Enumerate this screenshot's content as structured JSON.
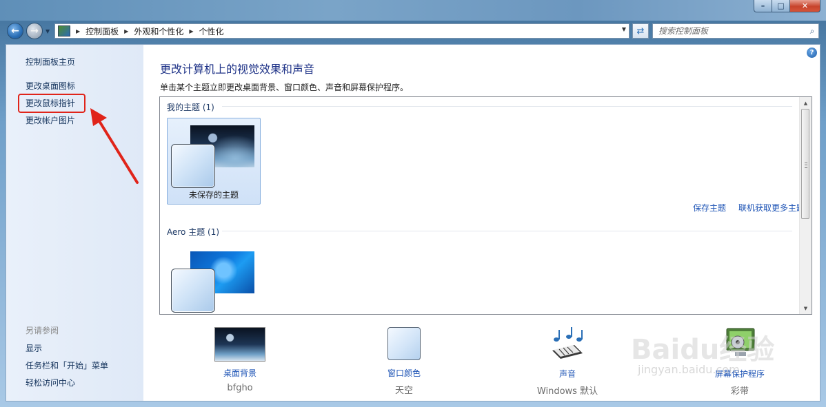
{
  "window": {
    "min_label": "–",
    "max_label": "□",
    "close_label": "✕"
  },
  "nav": {
    "breadcrumb": [
      "控制面板",
      "外观和个性化",
      "个性化"
    ],
    "search_placeholder": "搜索控制面板"
  },
  "sidebar": {
    "home": "控制面板主页",
    "links": [
      "更改桌面图标",
      "更改鼠标指针",
      "更改帐户图片"
    ],
    "see_also_header": "另请参阅",
    "see_also": [
      "显示",
      "任务栏和「开始」菜单",
      "轻松访问中心"
    ]
  },
  "main": {
    "title": "更改计算机上的视觉效果和声音",
    "description": "单击某个主题立即更改桌面背景、窗口颜色、声音和屏幕保护程序。",
    "groups": [
      {
        "header": "我的主题 (1)",
        "themes": [
          {
            "label": "未保存的主题"
          }
        ]
      },
      {
        "header": "Aero 主题 (1)",
        "themes": [
          {
            "label": ""
          }
        ]
      }
    ],
    "save_theme": "保存主题",
    "more_themes": "联机获取更多主题"
  },
  "bottom": [
    {
      "title": "桌面背景",
      "value": "bfgho",
      "icon": "wallpaper-icon"
    },
    {
      "title": "窗口颜色",
      "value": "天空",
      "icon": "window-color-icon"
    },
    {
      "title": "声音",
      "value": "Windows 默认",
      "icon": "sound-icon"
    },
    {
      "title": "屏幕保护程序",
      "value": "彩带",
      "icon": "screensaver-icon"
    }
  ],
  "watermark": {
    "main": "Baidu经验",
    "sub": "jingyan.baidu.com"
  },
  "colors": {
    "annotation_red": "#e0241a",
    "link_blue": "#1f55b6",
    "heading_blue": "#1e3287"
  }
}
